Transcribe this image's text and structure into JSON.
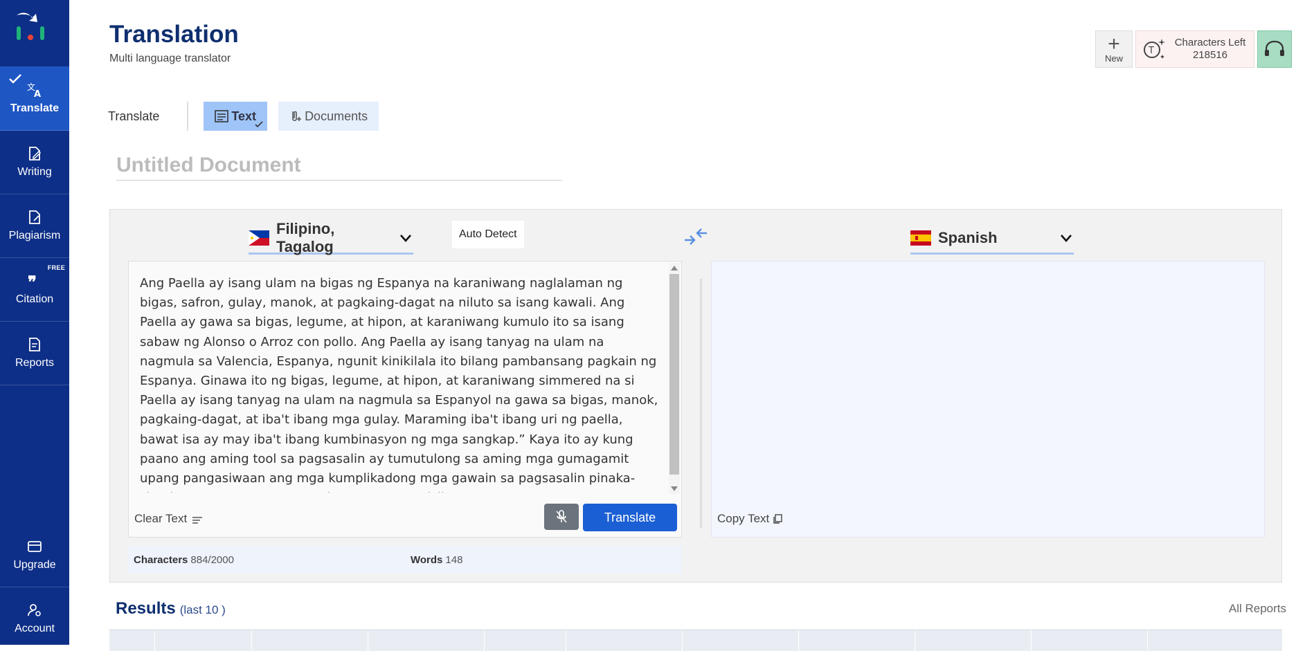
{
  "app": {
    "title": "Translation",
    "subtitle": "Multi language translator"
  },
  "sidebar": {
    "items": [
      {
        "label": "Translate",
        "icon": "translate-icon",
        "active": true
      },
      {
        "label": "Writing",
        "icon": "writing-icon"
      },
      {
        "label": "Plagiarism",
        "icon": "plagiarism-icon"
      },
      {
        "label": "Citation",
        "icon": "quote-icon",
        "badge": "FREE"
      },
      {
        "label": "Reports",
        "icon": "reports-icon"
      }
    ],
    "bottom_items": [
      {
        "label": "Upgrade",
        "icon": "card-icon"
      },
      {
        "label": "Account",
        "icon": "account-settings-icon"
      }
    ]
  },
  "top_actions": {
    "new_label": "New",
    "characters_left_label": "Characters Left",
    "characters_left_value": "218516"
  },
  "mode": {
    "label": "Translate",
    "tabs": [
      {
        "label": "Text",
        "selected": true
      },
      {
        "label": "Documents",
        "selected": false
      }
    ]
  },
  "document": {
    "title_placeholder": "Untitled Document"
  },
  "translator": {
    "source_language": "Filipino, Tagalog",
    "target_language": "Spanish",
    "auto_detect_label": "Auto Detect",
    "source_text": "Ang Paella ay isang ulam na bigas ng Espanya na karaniwang naglalaman ng bigas, safron, gulay, manok, at pagkaing-dagat na niluto sa isang kawali. Ang Paella ay gawa sa bigas, legume, at hipon, at karaniwang kumulo ito sa isang sabaw ng Alonso o Arroz con pollo. Ang Paella ay isang tanyag na ulam na nagmula sa Valencia, Espanya, ngunit kinikilala ito bilang pambansang pagkain ng Espanya. Ginawa ito ng bigas, legume, at hipon, at karaniwang simmered na si Paella ay isang tanyag na ulam na nagmula sa Espanyol na gawa sa bigas, manok, pagkaing-dagat, at iba't ibang mga gulay. Maraming iba't ibang uri ng paella, bawat isa ay may iba't ibang kumbinasyon ng mga sangkap.” Kaya ito ay kung paano ang aming tool sa pagsasalin ay tumutulong sa aming mga gumagamit upang pangasiwaan ang mga kumplikadong mga gawain sa pagsasalin pinaka-simple at pag-save ng maraming oras at pagsisikap.",
    "clear_text_label": "Clear Text",
    "translate_button_label": "Translate",
    "copy_text_label": "Copy Text",
    "characters_label": "Characters",
    "characters_value": "884/2000",
    "words_label": "Words",
    "words_value": "148"
  },
  "results": {
    "title": "Results",
    "subtitle": "(last 10 )",
    "all_reports_label": "All Reports"
  },
  "colors": {
    "sidebar_bg": "#0e2f87",
    "active_nav": "#1e56c4",
    "primary_button": "#1b5fd4",
    "title_text": "#0e2f6f"
  }
}
